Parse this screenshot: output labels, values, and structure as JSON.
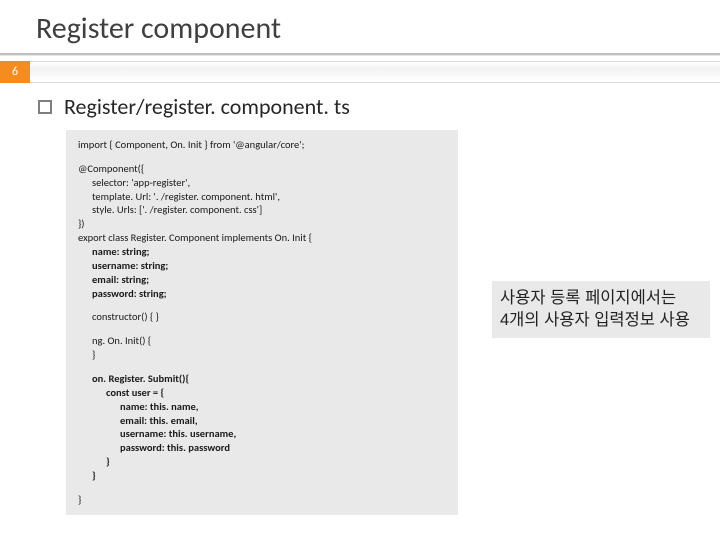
{
  "title": "Register component",
  "page_number": "6",
  "subtitle": "Register/register. component. ts",
  "code": {
    "import_line": "import { Component, On. Init } from '@angular/core';",
    "decorator_open": "@Component({",
    "selector": "selector: 'app-register',",
    "template_url": "template. Url: '. /register. component. html',",
    "style_urls": "style. Urls: ['. /register. component. css']",
    "decorator_close": "})",
    "class_decl": "export class Register. Component implements On. Init {",
    "field_name": "name: string;",
    "field_username": "username: string;",
    "field_email": "email: string;",
    "field_password": "password: string;",
    "ctor": "constructor() { }",
    "ngoninit_open": "ng. On. Init() {",
    "ngoninit_close": "}",
    "submit_open": "on. Register. Submit(){",
    "user_open": "const user = {",
    "u_name": "name: this. name,",
    "u_email": "email: this. email,",
    "u_username": "username: this. username,",
    "u_password": "password: this. password",
    "user_close": "}",
    "submit_close": "}",
    "class_close": "}"
  },
  "callout": {
    "line1": "사용자 등록 페이지에서는",
    "line2": "4개의 사용자 입력정보 사용"
  }
}
